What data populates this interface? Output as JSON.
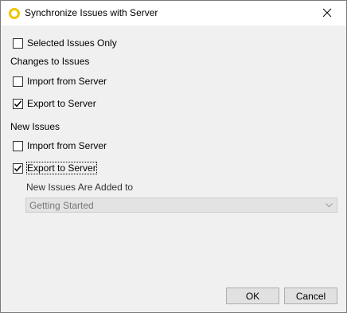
{
  "window": {
    "title": "Synchronize Issues with Server"
  },
  "options": {
    "selected_only": {
      "label": "Selected Issues Only",
      "checked": false
    }
  },
  "changes": {
    "heading": "Changes to Issues",
    "import": {
      "label": "Import from Server",
      "checked": false
    },
    "export": {
      "label": "Export to Server",
      "checked": true
    }
  },
  "new_issues": {
    "heading": "New Issues",
    "import": {
      "label": "Import from Server",
      "checked": false
    },
    "export": {
      "label": "Export to Server",
      "checked": true
    },
    "added_to_label": "New Issues Are Added to",
    "added_to_value": "Getting Started"
  },
  "buttons": {
    "ok": "OK",
    "cancel": "Cancel"
  },
  "colors": {
    "app_icon": "#f2c500",
    "disabled_select_bg": "#e3e3e3"
  }
}
